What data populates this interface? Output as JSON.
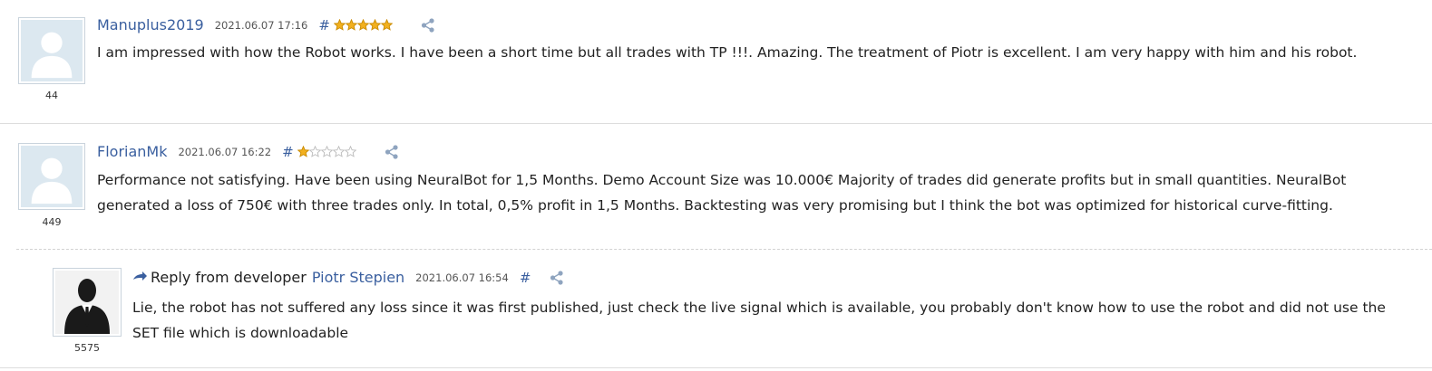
{
  "reviews": [
    {
      "author": "Manuplus2019",
      "date": "2021.06.07 17:16",
      "hash": "#",
      "rating": 5,
      "count": "44",
      "text": "I am impressed with how the Robot works. I have been a short time but all trades with TP !!!. Amazing. The treatment of Piotr is excellent. I am very happy with him and his robot."
    },
    {
      "author": "FlorianMk",
      "date": "2021.06.07 16:22",
      "hash": "#",
      "rating": 1,
      "count": "449",
      "text": "Performance not satisfying. Have been using NeuralBot for 1,5 Months. Demo Account Size was 10.000€ Majority of trades did generate profits but in small quantities. NeuralBot generated a loss of 750€ with three trades only. In total, 0,5% profit in 1,5 Months. Backtesting was very promising but I think the bot was optimized for historical curve-fitting."
    }
  ],
  "reply": {
    "prefix": "Reply from developer",
    "author": "Piotr Stepien",
    "date": "2021.06.07 16:54",
    "hash": "#",
    "count": "5575",
    "text": "Lie, the robot has not suffered any loss since it was first published, just check the live signal which is available, you probably don't know how to use the robot and did not use the SET file which is downloadable"
  },
  "colors": {
    "link": "#3a5f9f",
    "star_filled": "#f2b01e",
    "star_empty": "#bbbbbb",
    "avatar_bg": "#dce8f0",
    "avatar_figure": "#ffffff",
    "share": "#8fa4bf"
  },
  "icons": {
    "avatar": "default-user-avatar",
    "developer_avatar": "businessman-silhouette",
    "share": "share-icon",
    "reply": "reply-arrow-icon",
    "star": "star-icon"
  }
}
